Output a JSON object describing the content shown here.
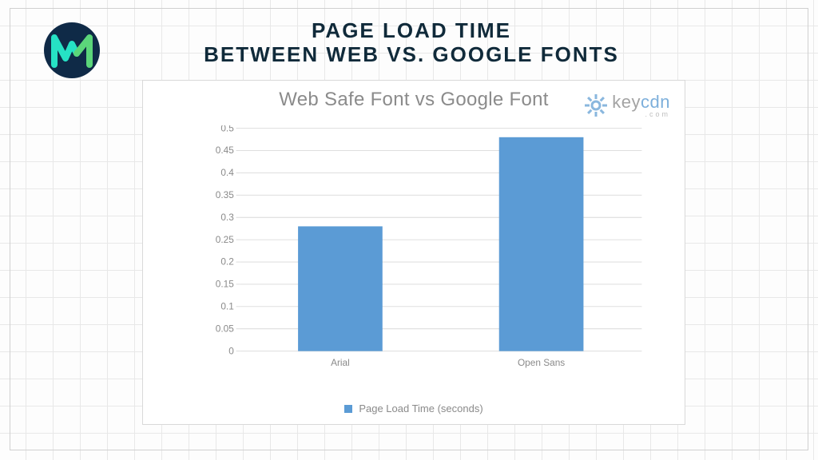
{
  "headline": {
    "line1": "PAGE LOAD TIME",
    "line2": "BETWEEN WEB VS. GOOGLE FONTS"
  },
  "logo": {
    "name": "brand-m-check-icon"
  },
  "watermark": {
    "brand_prefix": "key",
    "brand_suffix": "cdn",
    "sub": ".com"
  },
  "chart_data": {
    "type": "bar",
    "title": "Web Safe Font vs Google Font",
    "categories": [
      "Arial",
      "Open Sans"
    ],
    "values": [
      0.28,
      0.48
    ],
    "xlabel": "",
    "ylabel": "",
    "ylim": [
      0,
      0.5
    ],
    "ytick_step": 0.05,
    "legend": "Page Load Time (seconds)",
    "bar_color": "#5b9bd5"
  }
}
